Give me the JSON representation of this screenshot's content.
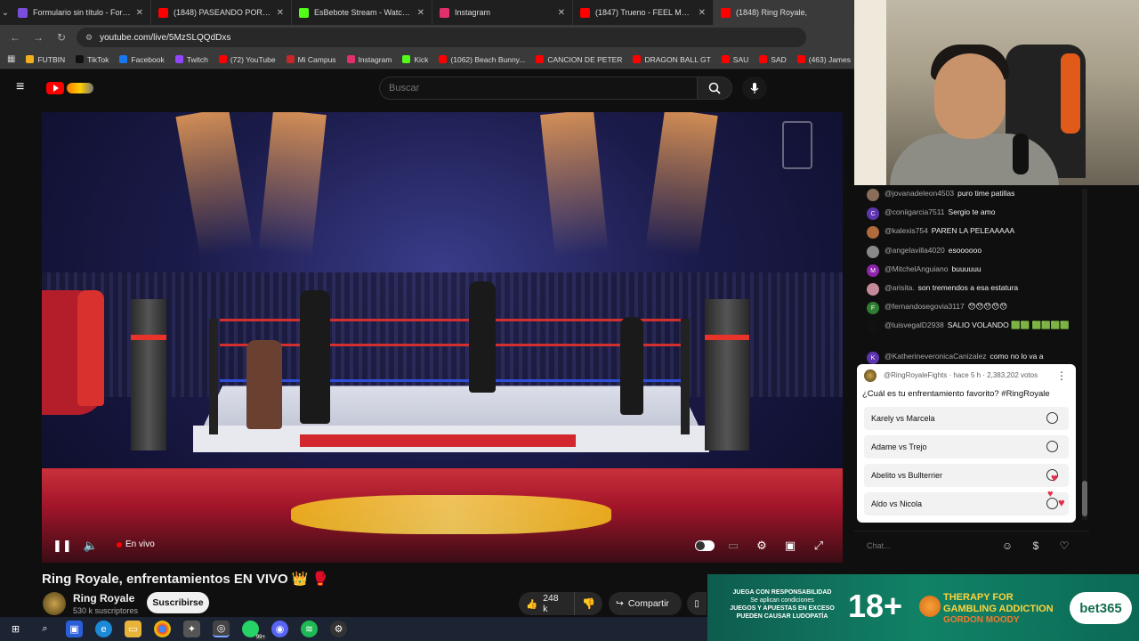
{
  "browser": {
    "tabs": [
      {
        "title": "Formulario sin título - Formulario",
        "color": "#7b4ddb",
        "active": false
      },
      {
        "title": "(1848) PASEANDO POR EL CENTRO",
        "color": "#ff0000",
        "active": false
      },
      {
        "title": "EsBebote Stream - Watch Live on Kick",
        "color": "#53fc18",
        "active": false
      },
      {
        "title": "Instagram",
        "color": "#e1306c",
        "active": false
      },
      {
        "title": "(1847) Trueno - FEEL ME?? (Video",
        "color": "#ff0000",
        "active": false
      },
      {
        "title": "(1848) Ring Royale,",
        "color": "#ff0000",
        "active": true
      }
    ],
    "url": "youtube.com/live/5MzSLQQdDxs",
    "bookmarks": [
      {
        "label": "FUTBIN",
        "color": "#f2b01e"
      },
      {
        "label": "TikTok",
        "color": "#111111"
      },
      {
        "label": "Facebook",
        "color": "#1877f2"
      },
      {
        "label": "Twitch",
        "color": "#9146ff"
      },
      {
        "label": "(72) YouTube",
        "color": "#ff0000"
      },
      {
        "label": "Mi Campus",
        "color": "#c62828"
      },
      {
        "label": "Instagram",
        "color": "#e1306c"
      },
      {
        "label": "Kick",
        "color": "#53fc18"
      },
      {
        "label": "(1062) Beach Bunny...",
        "color": "#ff0000"
      },
      {
        "label": "CANCION DE PETER",
        "color": "#ff0000"
      },
      {
        "label": "DRAGON BALL GT",
        "color": "#ff0000"
      },
      {
        "label": "SAU",
        "color": "#ff0000"
      },
      {
        "label": "SAD",
        "color": "#ff0000"
      },
      {
        "label": "(463) James",
        "color": "#ff0000"
      }
    ]
  },
  "youtube": {
    "search_placeholder": "Buscar",
    "live_label": "En vivo",
    "video_title": "Ring Royale, enfrentamientos EN VIVO 👑 🥊",
    "channel_name": "Ring Royale",
    "subscribers": "530 k suscriptores",
    "subscribe_label": "Suscribirse",
    "likes": "248 k",
    "share_label": "Compartir"
  },
  "chat": {
    "messages": [
      {
        "author": "@jovanadeleon4503",
        "text": "puro time patillas",
        "avatar": "",
        "avatar_color": "#8a6d5a"
      },
      {
        "author": "@coniigarcia7511",
        "text": "Sergio te amo",
        "avatar": "C",
        "avatar_color": "#5e35b1"
      },
      {
        "author": "@kalexis754",
        "text": "PAREN LA PELEAAAAA",
        "avatar": "",
        "avatar_color": "#b06a3b"
      },
      {
        "author": "@angelavilla4020",
        "text": "esoooooo",
        "avatar": "",
        "avatar_color": "#888888"
      },
      {
        "author": "@MitchelAnguiano",
        "text": "buuuuuu",
        "avatar": "M",
        "avatar_color": "#8e24aa"
      },
      {
        "author": "@arisita.",
        "text": "son tremendos a esa estatura",
        "avatar": "",
        "avatar_color": "#c48a9a"
      },
      {
        "author": "@fernandosegovia3117",
        "text": "😯😯😯😯😯",
        "avatar": "F",
        "avatar_color": "#2e7d32"
      },
      {
        "author": "@luisvegalD2938",
        "text": "SALIO VOLANDO 🟩🟩 🟩🟩🟩🟩",
        "avatar": "",
        "avatar_color": "#111111"
      },
      {
        "author": "@KatherineveronicaCanizalez",
        "text": "como no lo va a",
        "avatar": "K",
        "avatar_color": "#5e35b1"
      }
    ],
    "input_placeholder": "Chat..."
  },
  "poll": {
    "author": "@RingRoyaleFights · hace 5 h · 2,383,202 votos",
    "question": "¿Cuál es tu enfrentamiento favorito? #RingRoyale",
    "options": [
      "Karely vs Marcela",
      "Adame vs Trejo",
      "Abelito vs Bullterrier",
      "Aldo vs Nicola"
    ]
  },
  "ad": {
    "left_top": "JUEGA CON RESPONSABILIDAD",
    "left_sub": "Se aplican condiciones",
    "left_warn": "JUEGOS Y APUESTAS EN EXCESO PUEDEN CAUSAR LUDOPATÍA",
    "age": "18+",
    "therapy": "THERAPY FOR GAMBLING ADDICTION",
    "gordon": "GORDON MOODY",
    "brand": "bet365"
  },
  "taskbar": {
    "badge": "99+"
  }
}
